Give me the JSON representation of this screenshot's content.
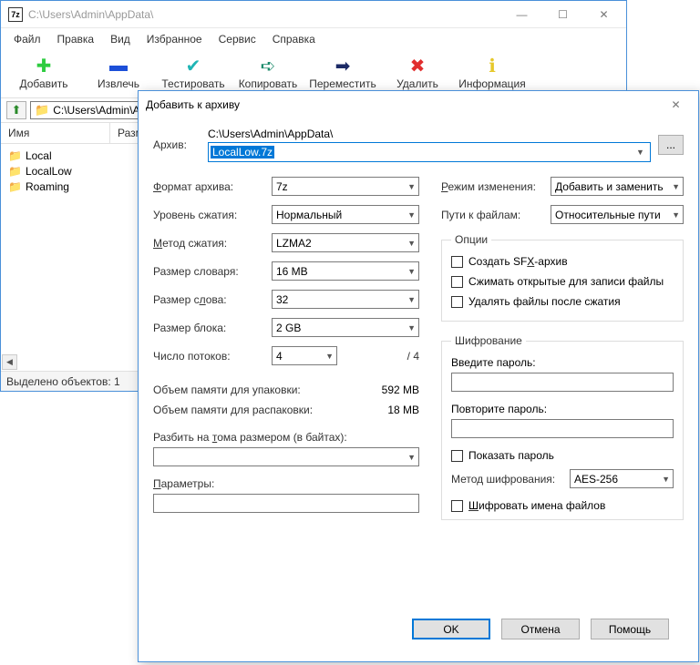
{
  "main_window": {
    "title": "C:\\Users\\Admin\\AppData\\",
    "menu": [
      "Файл",
      "Правка",
      "Вид",
      "Избранное",
      "Сервис",
      "Справка"
    ],
    "toolbar": [
      {
        "icon": "✚",
        "color": "#2ecc40",
        "label": "Добавить"
      },
      {
        "icon": "▬",
        "color": "#1c4fd8",
        "label": "Извлечь"
      },
      {
        "icon": "✔",
        "color": "#1fb5b5",
        "label": "Тестировать"
      },
      {
        "icon": "➪",
        "color": "#1a8a6a",
        "label": "Копировать"
      },
      {
        "icon": "➡",
        "color": "#1b2a66",
        "label": "Переместить"
      },
      {
        "icon": "✖",
        "color": "#e12e2e",
        "label": "Удалить"
      },
      {
        "icon": "ℹ",
        "color": "#e6c82a",
        "label": "Информация"
      }
    ],
    "path": "C:\\Users\\Admin\\AppData\\",
    "columns": [
      "Имя",
      "Размер"
    ],
    "items": [
      "Local",
      "LocalLow",
      "Roaming"
    ],
    "status": "Выделено объектов: 1"
  },
  "dialog": {
    "title": "Добавить к архиву",
    "archive_label": "Архив:",
    "archive_dir": "C:\\Users\\Admin\\AppData\\",
    "archive_name": "LocalLow.7z",
    "browse": "...",
    "left": {
      "format_label": "Формат архива:",
      "format_value": "7z",
      "level_label": "Уровень сжатия:",
      "level_value": "Нормальный",
      "method_label": "Метод сжатия:",
      "method_value": "LZMA2",
      "dict_label": "Размер словаря:",
      "dict_value": "16 MB",
      "word_label": "Размер слова:",
      "word_value": "32",
      "block_label": "Размер блока:",
      "block_value": "2 GB",
      "threads_label": "Число потоков:",
      "threads_value": "4",
      "threads_max": "/ 4",
      "mem_pack_label": "Объем памяти для упаковки:",
      "mem_pack_value": "592 MB",
      "mem_unpack_label": "Объем памяти для распаковки:",
      "mem_unpack_value": "18 MB",
      "volume_label": "Разбить на тома размером (в байтах):",
      "params_label": "Параметры:"
    },
    "right": {
      "update_label": "Режим изменения:",
      "update_value": "Добавить и заменить",
      "paths_label": "Пути к файлам:",
      "paths_value": "Относительные пути",
      "options_legend": "Опции",
      "opt_sfx": "Создать SFX-архив",
      "opt_shared": "Сжимать открытые для записи файлы",
      "opt_delete": "Удалять файлы после сжатия",
      "enc_legend": "Шифрование",
      "pw_label": "Введите пароль:",
      "pw2_label": "Повторите пароль:",
      "show_pw": "Показать пароль",
      "enc_method_label": "Метод шифрования:",
      "enc_method_value": "AES-256",
      "enc_names": "Шифровать имена файлов"
    },
    "buttons": {
      "ok": "OK",
      "cancel": "Отмена",
      "help": "Помощь"
    }
  }
}
